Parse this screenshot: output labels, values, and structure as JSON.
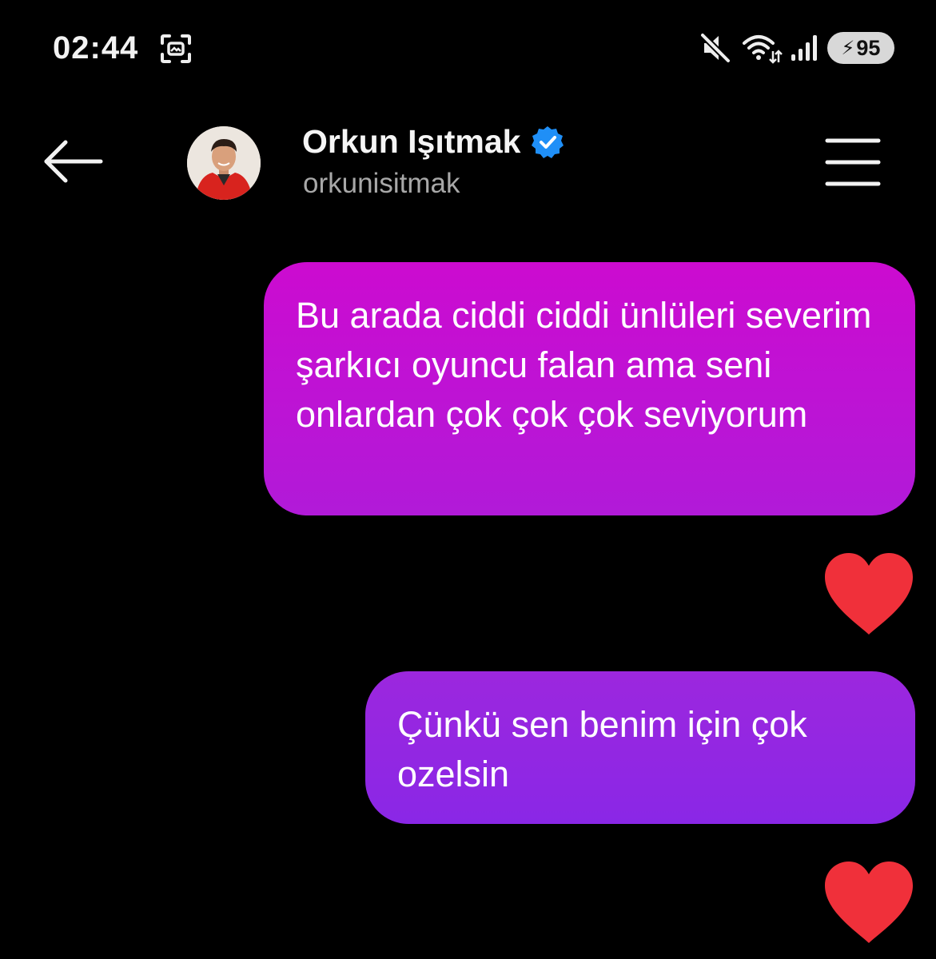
{
  "status_bar": {
    "time": "02:44",
    "icons": [
      "screenshot-icon",
      "mute-icon",
      "wifi-icon",
      "signal-icon",
      "charging-bolt-icon"
    ],
    "battery_level": "95"
  },
  "header": {
    "back_icon": "back-arrow-icon",
    "contact_name": "Orkun Işıtmak",
    "verified_icon": "verified-badge-icon",
    "handle": "orkunisitmak",
    "menu_icon": "hamburger-menu-icon"
  },
  "messages": [
    {
      "side": "sent",
      "text": "Bu arada ciddi ciddi ünlüleri severim şarkıcı oyuncu falan ama seni onlardan çok çok çok seviyorum",
      "reaction": "heart-icon"
    },
    {
      "side": "sent",
      "text": "Çünkü sen benim için çok ozelsin",
      "reaction": "heart-icon"
    }
  ],
  "colors": {
    "background": "#000000",
    "bubble_1_top": "#cc0bd0",
    "bubble_2": "#9c27de",
    "heart": "#f0303a",
    "verified": "#1f8ff7",
    "handle_text": "#a8a8a8"
  }
}
